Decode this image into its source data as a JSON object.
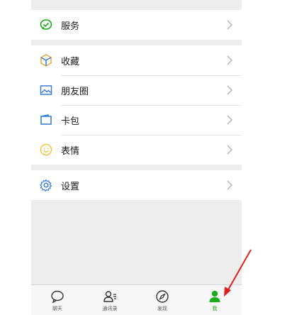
{
  "colors": {
    "accent_green": "#1aad19",
    "service_icon": "#1aad19",
    "favorites_icon": "#f0a53a",
    "moments_icon": "#3a7bd5",
    "cards_icon": "#2b7bd6",
    "stickers_icon": "#f5c242",
    "settings_icon": "#3a7bd5",
    "annotation_arrow": "#e02020"
  },
  "menu": {
    "service": {
      "label": "服务",
      "icon": "service-chat-check-icon"
    },
    "favorites": {
      "label": "收藏",
      "icon": "cube-icon"
    },
    "moments": {
      "label": "朋友圈",
      "icon": "photo-icon"
    },
    "cards": {
      "label": "卡包",
      "icon": "wallet-icon"
    },
    "stickers": {
      "label": "表情",
      "icon": "smiley-icon"
    },
    "settings": {
      "label": "设置",
      "icon": "gear-icon"
    }
  },
  "tabbar": {
    "chats": {
      "label": "聊天",
      "icon": "chat-bubble-icon"
    },
    "contacts": {
      "label": "通讯录",
      "icon": "contacts-icon"
    },
    "discover": {
      "label": "发现",
      "icon": "compass-icon"
    },
    "me": {
      "label": "我",
      "icon": "person-icon",
      "active": true
    }
  }
}
